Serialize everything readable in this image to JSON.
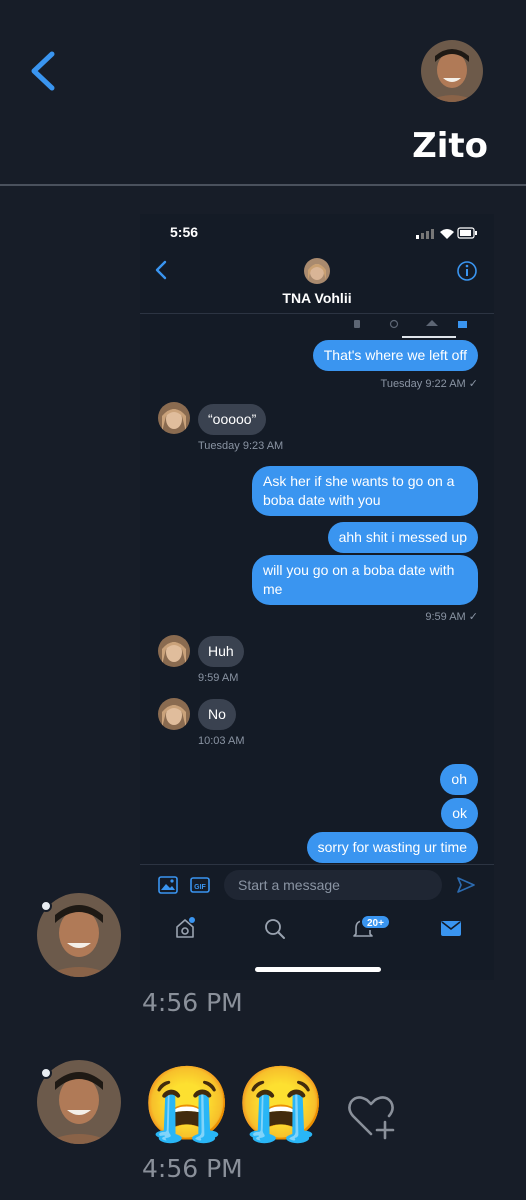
{
  "header": {
    "contact_name": "Zito"
  },
  "screenshot": {
    "status_time": "5:56",
    "chat_title": "TNA Vohlii",
    "messages": [
      {
        "text": "That's where we left off",
        "meta": "Tuesday 9:22 AM ✓"
      },
      {
        "text": "“ooooo”",
        "meta": "Tuesday 9:23 AM"
      },
      {
        "text": "Ask her if she wants to go on a boba date with you"
      },
      {
        "text": "ahh shit i messed up"
      },
      {
        "text": "will you go on a boba date with me",
        "meta": "9:59 AM ✓"
      },
      {
        "text": "Huh",
        "meta": "9:59 AM"
      },
      {
        "text": "No",
        "meta": "10:03 AM"
      },
      {
        "text": "oh"
      },
      {
        "text": "ok"
      },
      {
        "text": "sorry for wasting ur time"
      }
    ],
    "composer": {
      "placeholder": "Start a message",
      "gif_label": "GIF"
    },
    "nav": {
      "notification_badge": "20+"
    }
  },
  "thread": [
    {
      "timestamp": "4:56 PM"
    },
    {
      "reactions": [
        "😭",
        "😭"
      ],
      "timestamp": "4:56 PM"
    }
  ],
  "colors": {
    "accent": "#3a95f0",
    "background": "#171d28",
    "incoming_bubble": "#3a4250"
  },
  "icons": [
    "back-chevron-icon",
    "info-icon",
    "image-icon",
    "gif-icon",
    "send-icon",
    "home-icon",
    "search-icon",
    "bell-icon",
    "mail-icon",
    "heart-plus-icon"
  ]
}
